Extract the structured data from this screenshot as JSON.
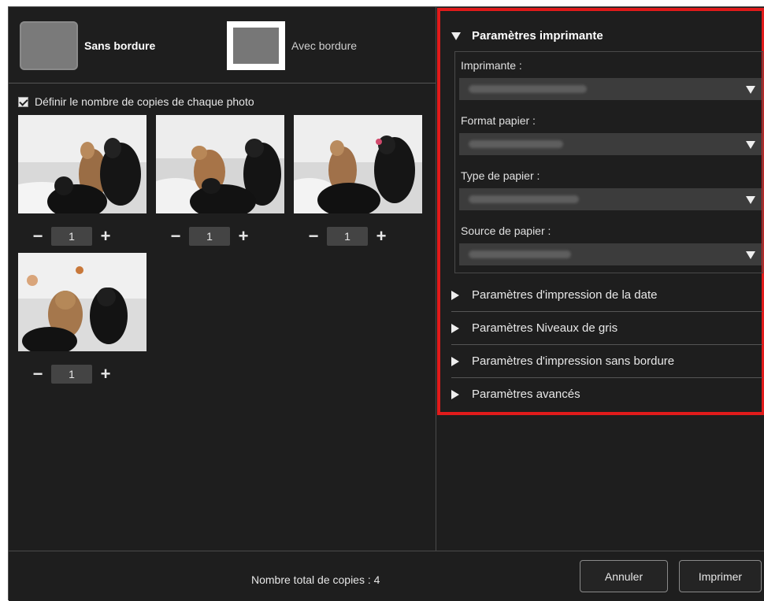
{
  "border_options": {
    "borderless_label": "Sans bordure",
    "bordered_label": "Avec bordure"
  },
  "copies": {
    "checkbox_label": "Définir le nombre de copies de chaque photo",
    "checked": true,
    "photos": [
      {
        "count": "1"
      },
      {
        "count": "1"
      },
      {
        "count": "1"
      },
      {
        "count": "1"
      }
    ],
    "minus_symbol": "−",
    "plus_symbol": "+"
  },
  "printer_settings": {
    "title": "Paramètres imprimante",
    "printer_label": "Imprimante :",
    "paper_size_label": "Format papier :",
    "paper_type_label": "Type de papier :",
    "paper_source_label": "Source de papier :"
  },
  "sections": [
    {
      "label": "Paramètres d'impression de la date"
    },
    {
      "label": "Paramètres Niveaux de gris"
    },
    {
      "label": "Paramètres d'impression sans bordure"
    },
    {
      "label": "Paramètres avancés"
    }
  ],
  "footer": {
    "total_copies": "Nombre total de copies : 4",
    "cancel_label": "Annuler",
    "print_label": "Imprimer"
  },
  "colors": {
    "highlight": "#e11b1b",
    "background": "#1e1e1e"
  }
}
